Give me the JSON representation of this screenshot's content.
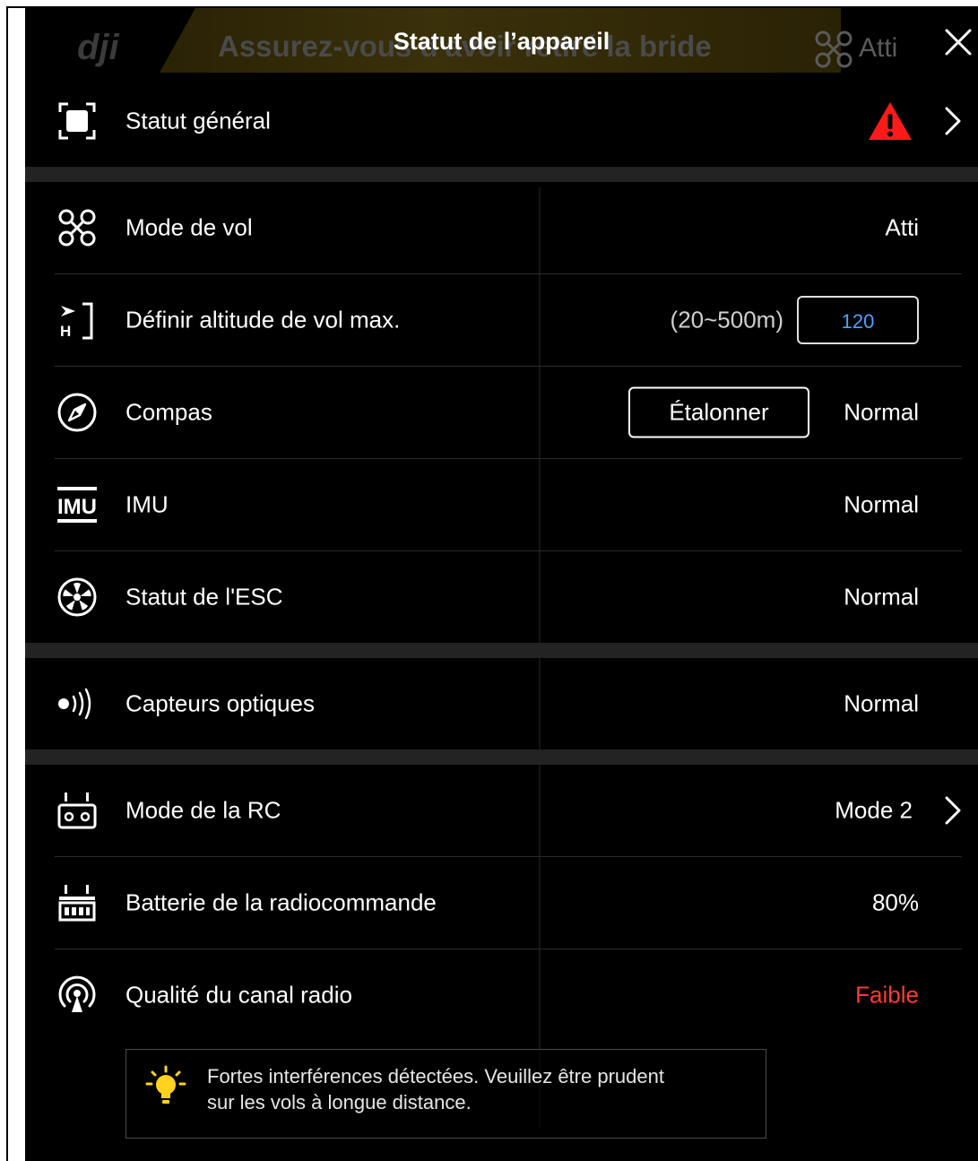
{
  "background": {
    "logo_text": "dji",
    "banner_text": "Assurez-vous d'avoir retiré la bride",
    "flight_mode_hud": "Atti"
  },
  "header": {
    "title": "Statut de l’appareil"
  },
  "rows": {
    "general": {
      "label": "Statut général",
      "status": "warning"
    },
    "flight_mode": {
      "label": "Mode de vol",
      "value": "Atti"
    },
    "max_altitude": {
      "label": "Définir altitude de vol max.",
      "range": "(20~500m)",
      "value": "120"
    },
    "compass": {
      "label": "Compas",
      "button": "Étalonner",
      "value": "Normal"
    },
    "imu": {
      "label": "IMU",
      "value": "Normal",
      "icon_text": "IMU"
    },
    "esc": {
      "label": "Statut de l'ESC",
      "value": "Normal"
    },
    "optical": {
      "label": "Capteurs optiques",
      "value": "Normal"
    },
    "rc_mode": {
      "label": "Mode de la RC",
      "value": "Mode 2"
    },
    "rc_battery": {
      "label": "Batterie de la radiocommande",
      "value": "80%"
    },
    "radio_quality": {
      "label": "Qualité du canal radio",
      "value": "Faible"
    }
  },
  "hint": {
    "text_line1": "Fortes interférences détectées. Veuillez être prudent",
    "text_line2": "sur les vols à longue distance."
  },
  "colors": {
    "background": "#000000",
    "accent_blue": "#4aa3ff",
    "warning_red": "#ff1a1a",
    "error_text": "#ff3b30",
    "bulb_yellow": "#ffd21f"
  },
  "icons": [
    "frame-icon",
    "drone-icon",
    "altitude-icon",
    "compass-icon",
    "imu-icon",
    "esc-icon",
    "optical-sensor-icon",
    "rc-icon",
    "rc-battery-icon",
    "radio-signal-icon",
    "warning-icon",
    "chevron-right-icon",
    "close-icon",
    "bulb-icon"
  ]
}
